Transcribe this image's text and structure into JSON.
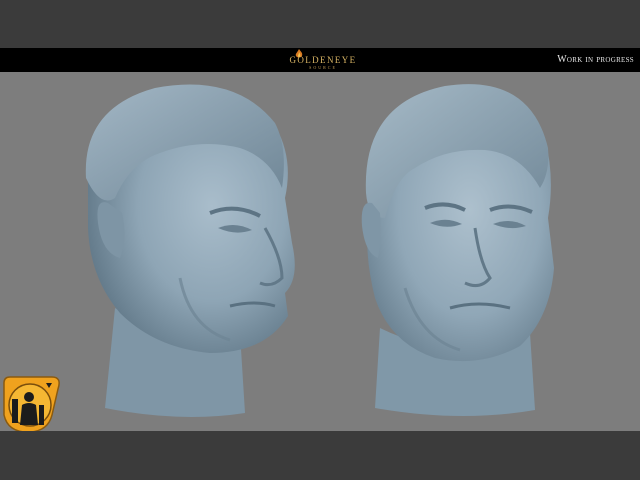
{
  "header": {
    "logo_text": "GOLDENEYE",
    "logo_subtext": "SOURCE",
    "status_text": "Work in progress"
  },
  "viewport": {
    "subject": "sculpted-head",
    "views": [
      "three-quarter-left",
      "three-quarter-front"
    ],
    "background_color": "#7d7d7d",
    "model_color": "#8fa6b6"
  },
  "badge": {
    "icon": "source-engine-badge-icon",
    "colors": [
      "#f0a21e",
      "#1c1c1c"
    ]
  }
}
